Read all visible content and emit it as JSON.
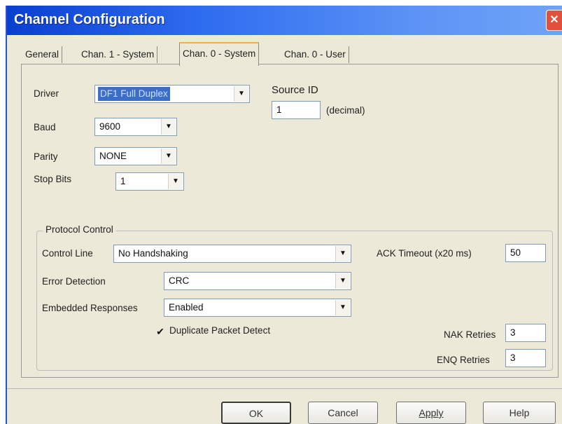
{
  "window": {
    "title": "Channel Configuration",
    "close_glyph": "✕"
  },
  "tabs": [
    {
      "label": "General",
      "active": false
    },
    {
      "label": "Chan. 1 - System",
      "active": false
    },
    {
      "label": "Chan. 0 - System",
      "active": true
    },
    {
      "label": "Chan. 0 - User",
      "active": false
    }
  ],
  "system": {
    "driver": {
      "label": "Driver",
      "value": "DF1 Full Duplex"
    },
    "baud": {
      "label": "Baud",
      "value": "9600"
    },
    "parity": {
      "label": "Parity",
      "value": "NONE"
    },
    "stop_bits": {
      "label": "Stop Bits",
      "value": "1"
    },
    "source_id": {
      "label": "Source ID",
      "value": "1",
      "unit": "(decimal)"
    }
  },
  "protocol": {
    "title": "Protocol Control",
    "control_line": {
      "label": "Control Line",
      "value": "No Handshaking"
    },
    "error_detection": {
      "label": "Error Detection",
      "value": "CRC"
    },
    "embedded_responses": {
      "label": "Embedded Responses",
      "value": "Enabled"
    },
    "duplicate_packet": {
      "label": "Duplicate Packet Detect",
      "checked": true,
      "glyph": "✔"
    },
    "ack_timeout": {
      "label": "ACK Timeout (x20 ms)",
      "value": "50"
    },
    "nak_retries": {
      "label": "NAK Retries",
      "value": "3"
    },
    "enq_retries": {
      "label": "ENQ Retries",
      "value": "3"
    }
  },
  "dropdown_glyph": "▼",
  "buttons": {
    "ok": "OK",
    "cancel": "Cancel",
    "apply": "Apply",
    "help": "Help"
  },
  "colors": {
    "title_gradient_start": "#0a3fd0",
    "dialog_bg": "#ece9d8",
    "selection": "#3a6ec9"
  }
}
